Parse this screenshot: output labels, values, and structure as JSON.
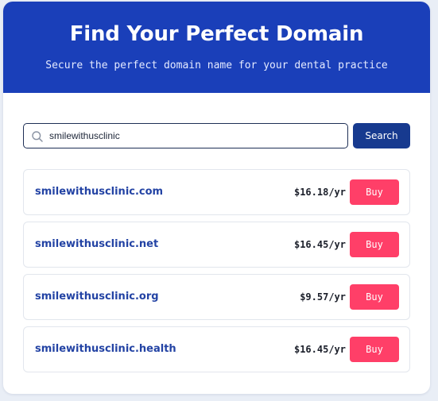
{
  "hero": {
    "title": "Find Your Perfect Domain",
    "subtitle": "Secure the perfect domain name for your dental practice"
  },
  "search": {
    "value": "smilewithusclinic",
    "icon": "search-icon",
    "button_label": "Search"
  },
  "results": [
    {
      "domain": "smilewithusclinic.com",
      "price": "$16.18/yr",
      "button_label": "Buy"
    },
    {
      "domain": "smilewithusclinic.net",
      "price": "$16.45/yr",
      "button_label": "Buy"
    },
    {
      "domain": "smilewithusclinic.org",
      "price": "$9.57/yr",
      "button_label": "Buy"
    },
    {
      "domain": "smilewithusclinic.health",
      "price": "$16.45/yr",
      "button_label": "Buy"
    }
  ],
  "colors": {
    "hero_background": "#1a3fb9",
    "search_button": "#173a8f",
    "domain_text": "#2343a4",
    "buy_button": "#ff3f68"
  }
}
